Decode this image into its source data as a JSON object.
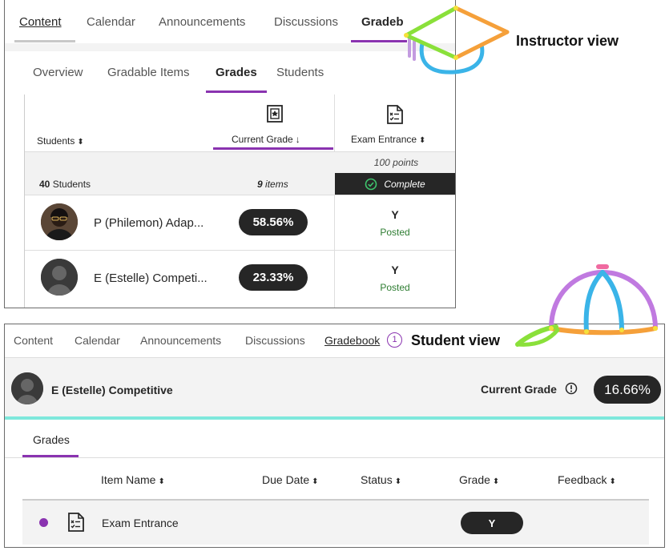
{
  "captions": {
    "instructor": "Instructor view",
    "student": "Student view"
  },
  "instructor": {
    "nav_tabs": [
      {
        "label": "Content",
        "active": true
      },
      {
        "label": "Calendar"
      },
      {
        "label": "Announcements"
      },
      {
        "label": "Discussions"
      },
      {
        "label": "Gradeb"
      }
    ],
    "sub_tabs": [
      {
        "label": "Overview"
      },
      {
        "label": "Gradable Items"
      },
      {
        "label": "Grades",
        "active": true
      },
      {
        "label": "Students"
      }
    ],
    "columns": {
      "students": "Students",
      "current_grade": "Current Grade",
      "exam_entrance": "Exam Entrance"
    },
    "sort": {
      "updown": "⬍",
      "down": "↓"
    },
    "exam_points": "100 points",
    "summary": {
      "count_num": "40",
      "count_label": " Students",
      "items_num": "9",
      "items_label": " items",
      "status": "Complete"
    },
    "rows": [
      {
        "name": "P (Philemon) Adap...",
        "grade": "58.56%",
        "exam_value": "Y",
        "exam_status": "Posted"
      },
      {
        "name": "E (Estelle) Competi...",
        "grade": "23.33%",
        "exam_value": "Y",
        "exam_status": "Posted"
      }
    ]
  },
  "student": {
    "nav_tabs": [
      {
        "label": "Content"
      },
      {
        "label": "Calendar"
      },
      {
        "label": "Announcements"
      },
      {
        "label": "Discussions"
      },
      {
        "label": "Gradebook",
        "active": true,
        "badge": "1"
      }
    ],
    "user_name": "E (Estelle) Competitive",
    "current_grade_label": "Current Grade",
    "current_grade_value": "16.66%",
    "tab": "Grades",
    "columns": {
      "item_name": "Item Name",
      "due_date": "Due Date",
      "status": "Status",
      "grade": "Grade",
      "feedback": "Feedback"
    },
    "rows": [
      {
        "item_name": "Exam Entrance",
        "grade": "Y"
      }
    ]
  },
  "colors": {
    "accent_purple": "#8a33b0",
    "teal": "#7ee8dc",
    "posted_green": "#2e7d32",
    "pill_dark": "#262626"
  },
  "icons": [
    "current-grade-icon",
    "exam-document-icon",
    "check-circle-icon",
    "info-icon",
    "graduation-cap-icon",
    "baseball-cap-icon",
    "unread-dot-icon"
  ]
}
